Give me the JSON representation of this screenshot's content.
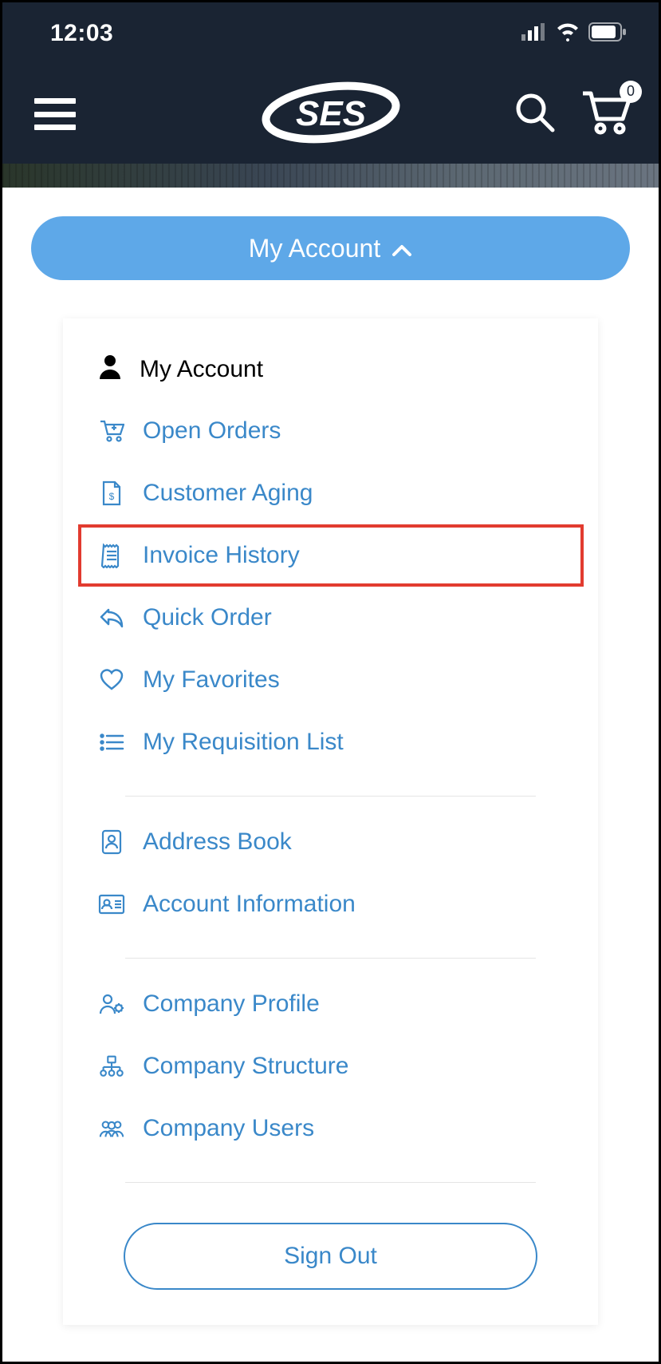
{
  "status": {
    "time": "12:03"
  },
  "header": {
    "logo_text": "SES",
    "cart_count": "0"
  },
  "account_button": {
    "label": "My Account"
  },
  "menu": {
    "header": "My Account",
    "items": [
      {
        "label": "Open Orders",
        "icon": "cart-plus-icon",
        "highlighted": false
      },
      {
        "label": "Customer Aging",
        "icon": "file-dollar-icon",
        "highlighted": false
      },
      {
        "label": "Invoice History",
        "icon": "receipt-icon",
        "highlighted": true
      },
      {
        "label": "Quick Order",
        "icon": "reply-icon",
        "highlighted": false
      },
      {
        "label": "My Favorites",
        "icon": "heart-icon",
        "highlighted": false
      },
      {
        "label": "My Requisition List",
        "icon": "list-icon",
        "highlighted": false
      }
    ],
    "items2": [
      {
        "label": "Address Book",
        "icon": "contact-icon"
      },
      {
        "label": "Account Information",
        "icon": "id-card-icon"
      }
    ],
    "items3": [
      {
        "label": "Company Profile",
        "icon": "user-gear-icon"
      },
      {
        "label": "Company Structure",
        "icon": "org-icon"
      },
      {
        "label": "Company Users",
        "icon": "users-icon"
      }
    ],
    "signout": "Sign Out"
  }
}
